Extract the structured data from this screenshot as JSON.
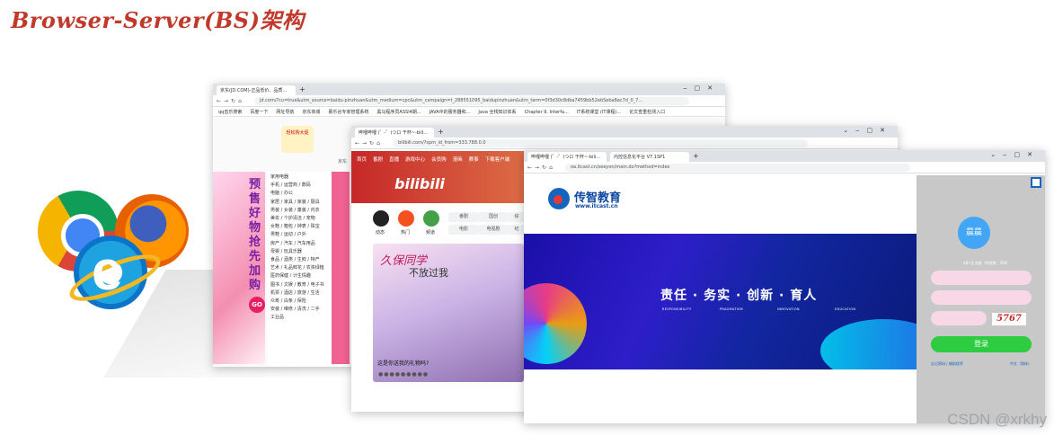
{
  "title": "Browser-Server(BS)架构",
  "watermark": "CSDN @xrkhy",
  "logos": {
    "chrome": "chrome-logo",
    "firefox": "firefox-logo",
    "ie": "ie-logo"
  },
  "win1": {
    "tab": "京东(JD.COM)-正品低价、品质...",
    "url": "jd.com/?cu=true&utm_source=baidu-pinzhuan&utm_medium=cpc&utm_campaign=t_288551095_baidupinzhuan&utm_term=0f3d30c8dba7459bb52ebSeba8ac7d_0_7...",
    "bookmarks": [
      "qq音乐搜索",
      "百度一下",
      "网址导航",
      "京东商城",
      "慕乐谷专家管理系统",
      "黑马程序员ASSI4期...",
      "JAVA中的服务器和...",
      "Java 全栈知识体系",
      "Chapter 9. Interfa...",
      "IT系统课堂 (IT课程)...",
      "论文查重检测入口"
    ],
    "jd_logo": "轻松购大促",
    "city": "京东",
    "menu": [
      "家用电器",
      "手机 / 运营商 / 数码",
      "电脑 / 办公",
      "家居 / 家具 / 家装 / 厨具",
      "男装 / 女装 / 童装 / 内衣",
      "美妆 / 个护清洁 / 宠物",
      "女鞋 / 箱包 / 钟表 / 珠宝",
      "男鞋 / 运动 / 户外",
      "房产 / 汽车 / 汽车用品",
      "母婴 / 玩具乐器",
      "食品 / 酒类 / 生鲜 / 特产",
      "艺术 / 礼品鲜花 / 农资绿植",
      "医药保健 / 计生情趣",
      "图书 / 文娱 / 教育 / 电子书",
      "机票 / 酒店 / 旅游 / 生活",
      "众筹 / 白条 / 保险",
      "安装 / 维修 / 清洗 / 二手",
      "工业品"
    ],
    "ad": "预售好物抢先加购",
    "go": "GO"
  },
  "win2": {
    "tab": "哔哩哔哩 (゜-゜)つロ 干杯~-bili...",
    "url": "bilibili.com/?spm_id_from=333.788.0.0",
    "nav": [
      "首页",
      "番剧",
      "直播",
      "游戏中心",
      "会员购",
      "漫画",
      "赛事",
      "下载客户端"
    ],
    "logo": "bilibili",
    "icons": [
      {
        "label": "动态"
      },
      {
        "label": "热门"
      },
      {
        "label": "频道"
      }
    ],
    "chips": [
      "番剧",
      "国创",
      "综",
      "电影",
      "电视剧",
      "纪"
    ],
    "card_t1": "久保同学",
    "card_t2": "不放过我",
    "caption": "这是你送我的礼物吗?",
    "dots": "●●●●●●●●●"
  },
  "win3": {
    "tab1": "哔哩哔哩 (゜-゜)つロ 干杯~-bili...",
    "tab2": "内控信息化平台 V7.1SP1",
    "url": "oa.itcast.cn/seeyon/main.do?method=index",
    "brand": "传智教育",
    "brand_url": "www.itcast.cn",
    "slogan": "责任 · 务实 · 创新 · 育人",
    "slogan_en": [
      "RESPONSIBILITY",
      "PRAGMATISM",
      "INNOVATION",
      "EDUCATION"
    ],
    "avatar": "晨晨",
    "side_note": "A8+企业版（并发数：500）",
    "captcha": "5767",
    "login": "登录",
    "link_left": "忘记密码 | 辅助程序",
    "link_right": "中文（简体）"
  }
}
